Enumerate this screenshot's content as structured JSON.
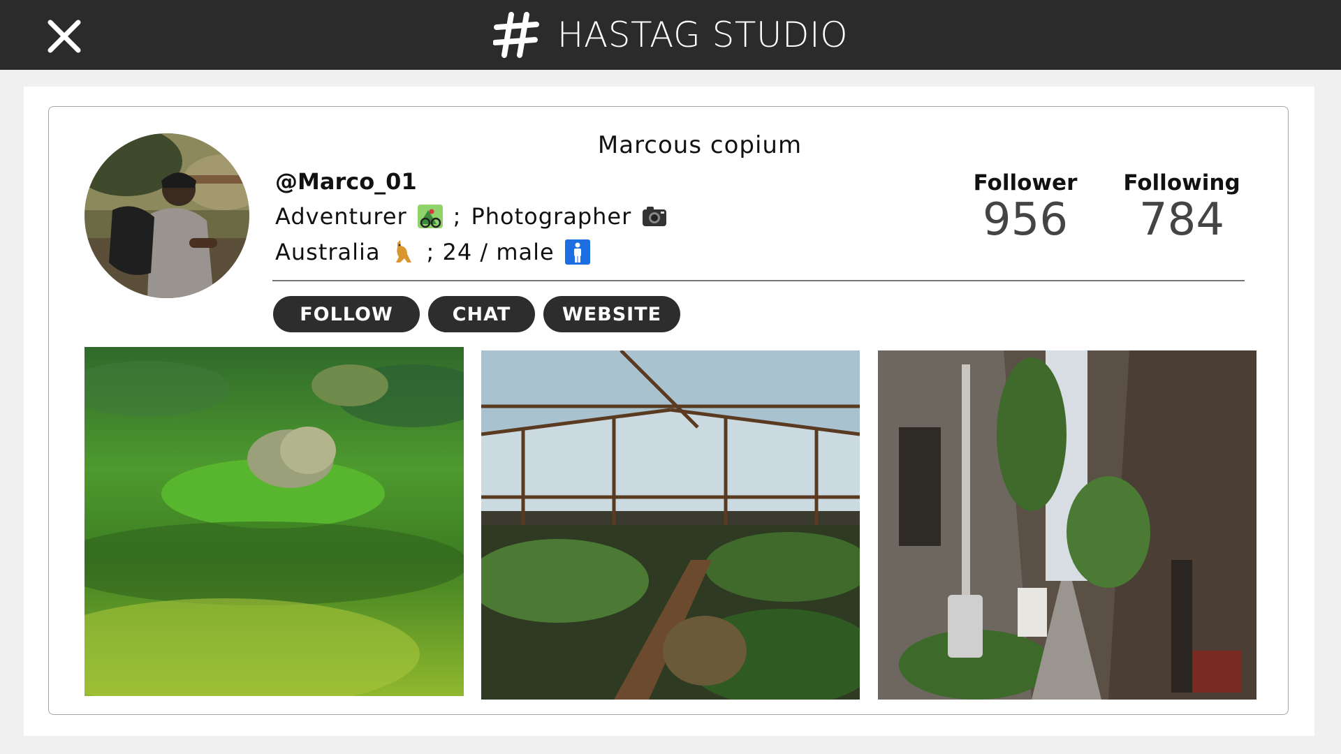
{
  "header": {
    "brand_name": "HASTAG STUDIO",
    "logo_icon": "hashtag-icon",
    "close_icon": "close-icon",
    "background": "#2b2b2b"
  },
  "profile": {
    "display_name": "Marcous copium",
    "username": "@Marco_01",
    "bio_line1": {
      "role1": "Adventurer",
      "role1_icon": "mountain-biking-emoji",
      "separator": ";",
      "role2": "Photographer",
      "role2_icon": "camera-emoji"
    },
    "bio_line2": {
      "country": "Australia",
      "country_icon": "kangaroo-emoji",
      "details": "; 24 / male",
      "gender_icon": "mens-symbol-emoji"
    },
    "stats": {
      "followers_label": "Follower",
      "followers_value": "956",
      "following_label": "Following",
      "following_value": "784"
    }
  },
  "actions": {
    "follow_label": "FOLLOW",
    "chat_label": "CHAT",
    "website_label": "WEBSITE"
  },
  "gallery": [
    {
      "subject": "moss-covered stones in green field"
    },
    {
      "subject": "greenhouse interior with plants"
    },
    {
      "subject": "narrow city alley with plants"
    }
  ]
}
